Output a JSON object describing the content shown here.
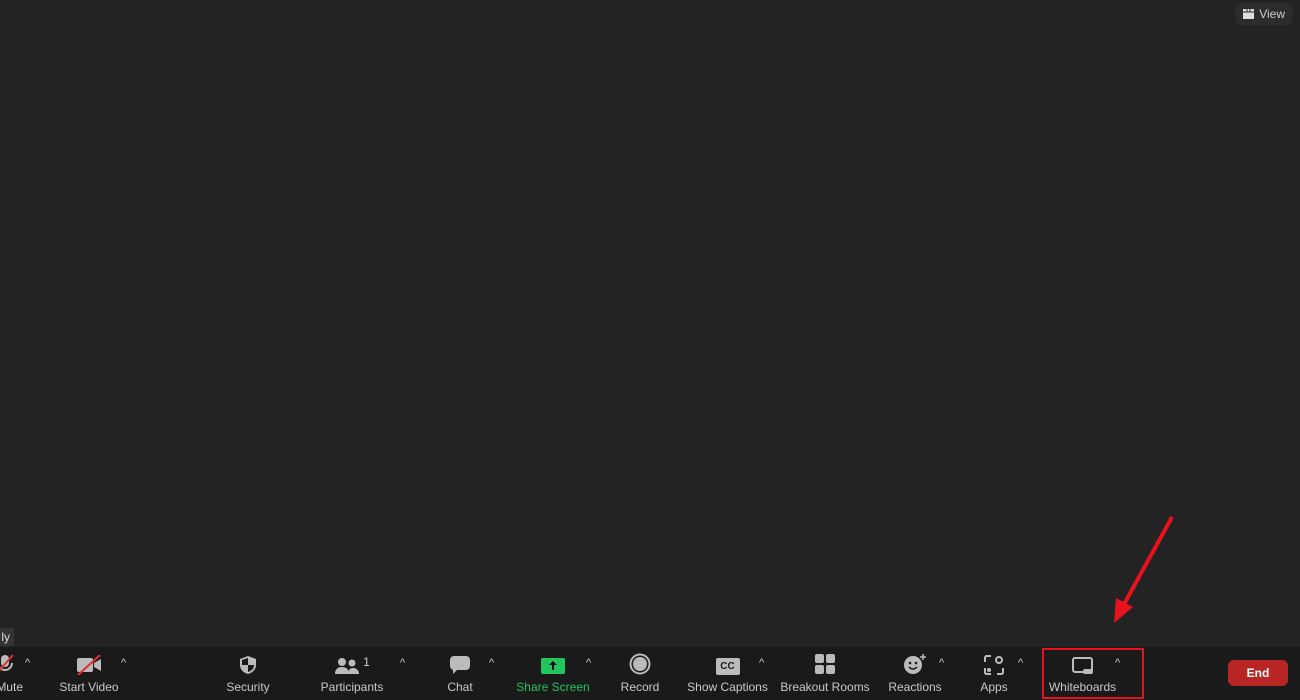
{
  "view_button": {
    "label": "View",
    "icon": "grid-icon"
  },
  "tooltip": {
    "text": "ly"
  },
  "toolbar": {
    "items": [
      {
        "label": "Mute",
        "icon": "microphone-muted-icon"
      },
      {
        "label": "Start Video",
        "icon": "video-off-icon"
      },
      {
        "label": "Security",
        "icon": "shield-icon"
      },
      {
        "label": "Participants",
        "icon": "participants-icon",
        "count": "1"
      },
      {
        "label": "Chat",
        "icon": "chat-icon"
      },
      {
        "label": "Share Screen",
        "icon": "share-screen-icon"
      },
      {
        "label": "Record",
        "icon": "record-icon"
      },
      {
        "label": "Show Captions",
        "icon": "cc-icon",
        "icon_text": "CC"
      },
      {
        "label": "Breakout Rooms",
        "icon": "breakout-rooms-icon"
      },
      {
        "label": "Reactions",
        "icon": "reactions-icon"
      },
      {
        "label": "Apps",
        "icon": "apps-icon"
      },
      {
        "label": "Whiteboards",
        "icon": "whiteboard-icon"
      }
    ],
    "end_label": "End"
  },
  "colors": {
    "background": "#232323",
    "toolbar": "#1a1a1a",
    "share_green": "#22c55e",
    "end_red": "#b82525",
    "annotation_red": "#e8121f"
  }
}
